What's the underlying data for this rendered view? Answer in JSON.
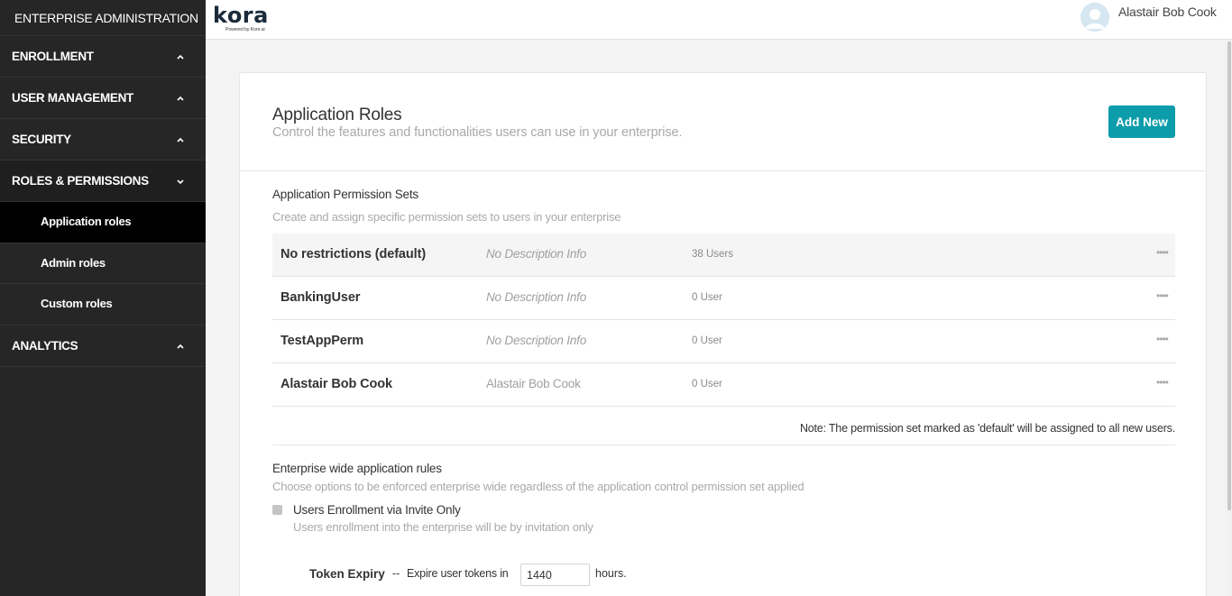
{
  "sidebar": {
    "header": "ENTERPRISE ADMINISTRATION",
    "sections": [
      {
        "label": "ENROLLMENT"
      },
      {
        "label": "USER MANAGEMENT"
      },
      {
        "label": "SECURITY"
      },
      {
        "label": "ROLES & PERMISSIONS"
      }
    ],
    "sub_items": [
      {
        "label": "Application roles"
      },
      {
        "label": "Admin roles"
      },
      {
        "label": "Custom roles"
      }
    ],
    "analytics": {
      "label": "ANALYTICS"
    }
  },
  "topbar": {
    "logo_text": "kora",
    "logo_sub": "Powered by Kore.ai",
    "username": "Alastair Bob Cook"
  },
  "header": {
    "title": "Application Roles",
    "subtitle": "Control the features and functionalities users can use in your enterprise.",
    "add_button": "Add New"
  },
  "permission_sets": {
    "title": "Application Permission Sets",
    "subtitle": "Create and assign specific permission sets to users in your enterprise",
    "rows": [
      {
        "name": "No restrictions  (default)",
        "description": "No Description Info",
        "users": "38 Users",
        "more": "••••"
      },
      {
        "name": "BankingUser",
        "description": "No Description Info",
        "users": "0 User",
        "more": "••••"
      },
      {
        "name": "TestAppPerm",
        "description": "No Description Info",
        "users": "0 User",
        "more": "••••"
      },
      {
        "name": "Alastair Bob Cook",
        "description": "Alastair Bob Cook",
        "users": "0 User",
        "more": "••••"
      }
    ],
    "note": "Note: The permission set marked as 'default' will be assigned to all new users."
  },
  "rules": {
    "title": "Enterprise wide application rules",
    "subtitle": "Choose options to be enforced enterprise wide regardless of the application control permission set applied",
    "invite_only": {
      "label": "Users Enrollment via Invite Only",
      "description": "Users enrollment into the enterprise will be by invitation only"
    },
    "token": {
      "label": "Token Expiry",
      "separator": "--",
      "text": "Expire user tokens in",
      "value": "1440",
      "unit": "hours."
    }
  },
  "colors": {
    "sidebar_bg": "#262626",
    "accent": "#0d9caa"
  }
}
